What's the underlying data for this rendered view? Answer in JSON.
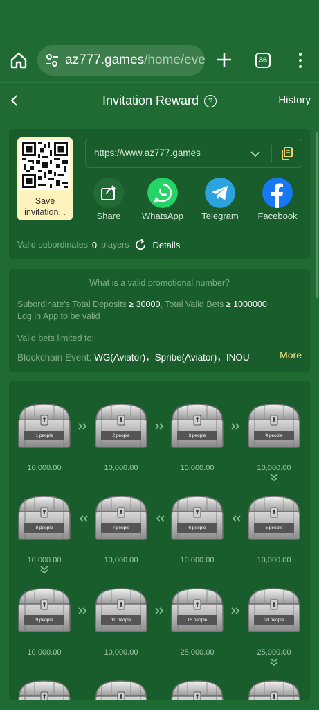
{
  "browser": {
    "url_domain": "az777.games",
    "url_path": "/home/ever",
    "tab_count": "36"
  },
  "header": {
    "title": "Invitation Reward",
    "help_glyph": "?",
    "history_label": "History"
  },
  "invite": {
    "save_label": "Save invitation...",
    "link": "https://www.az777.games",
    "share": [
      {
        "label": "Share",
        "icon": "share-icon"
      },
      {
        "label": "WhatsApp",
        "icon": "whatsapp-icon"
      },
      {
        "label": "Telegram",
        "icon": "telegram-icon"
      },
      {
        "label": "Facebook",
        "icon": "facebook-icon"
      }
    ],
    "valid_label": "Valid subordinates",
    "valid_count": "0",
    "valid_unit": "players",
    "details_label": "Details"
  },
  "rules": {
    "title": "What is a valid promotional number?",
    "deposits_label": "Subordinate's Total Deposits",
    "deposits_value": "≥ 30000",
    "bets_label": "Total Valid Bets",
    "bets_value": "≥ 1000000",
    "login_note": "Log in App to be valid",
    "limited_label": "Valid bets limited to:",
    "chain_label": "Blockchain Event:",
    "chain_games": "WG(Aviator)，Spribe(Aviator)，INOU",
    "more_label": "More"
  },
  "rewards": [
    {
      "people": "1 people",
      "amount": "10,000.00"
    },
    {
      "people": "2 people",
      "amount": "10,000.00"
    },
    {
      "people": "3 people",
      "amount": "10,000.00"
    },
    {
      "people": "4 people",
      "amount": "10,000.00"
    },
    {
      "people": "5 people",
      "amount": "10,000.00"
    },
    {
      "people": "6 people",
      "amount": "10,000.00"
    },
    {
      "people": "7 people",
      "amount": "10,000.00"
    },
    {
      "people": "8 people",
      "amount": "10,000.00"
    },
    {
      "people": "9 people",
      "amount": "10,000.00"
    },
    {
      "people": "10 people",
      "amount": "10,000.00"
    },
    {
      "people": "15 people",
      "amount": "25,000.00"
    },
    {
      "people": "20 people",
      "amount": "25,000.00"
    }
  ],
  "colors": {
    "background": "#1f6b33",
    "card": "#1a5d2c",
    "accent_yellow": "#ffe27a",
    "muted_text": "#7fae8b"
  }
}
